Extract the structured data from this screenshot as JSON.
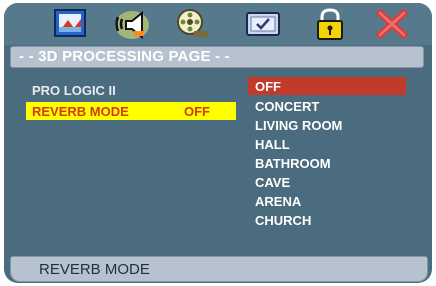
{
  "toolbar": {
    "icons": [
      "general-setup-icon",
      "audio-speaker-icon",
      "video-reel-icon",
      "screen-setup-icon",
      "lock-icon",
      "exit-icon"
    ]
  },
  "header": {
    "title": "- - 3D PROCESSING PAGE - -"
  },
  "settings": [
    {
      "label": "PRO LOGIC II",
      "value": ""
    },
    {
      "label": "REVERB MODE",
      "value": "OFF"
    }
  ],
  "options": [
    "OFF",
    "CONCERT",
    "LIVING ROOM",
    "HALL",
    "BATHROOM",
    "CAVE",
    "ARENA",
    "CHURCH"
  ],
  "footer": {
    "status": "REVERB MODE"
  },
  "colors": {
    "background": "#4b6b7e",
    "selection_yellow": "#ffff00",
    "highlight_red": "#c23a2a",
    "bar_gray": "#b6c2ce"
  }
}
